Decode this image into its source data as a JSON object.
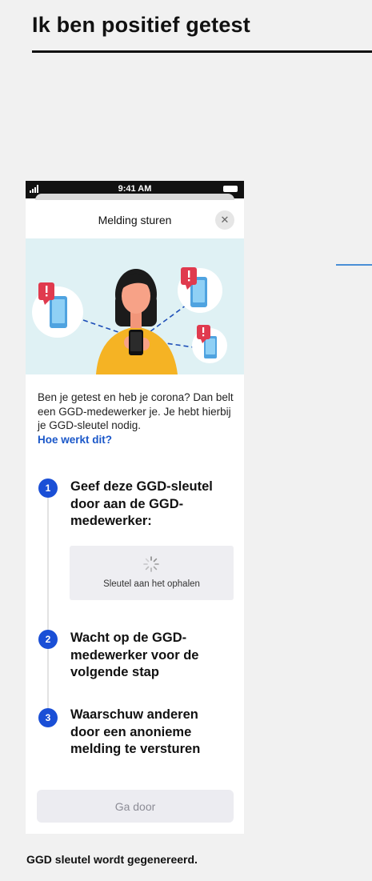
{
  "page": {
    "title": "Ik ben positief getest",
    "caption": "GGD sleutel wordt gegenereerd."
  },
  "statusbar": {
    "time": "9:41 AM"
  },
  "sheet": {
    "title": "Melding sturen",
    "close_icon": "close-icon",
    "intro_text": "Ben je getest en heb je corona? Dan belt een GGD-medewerker je. Je hebt hierbij je GGD-sleutel nodig.",
    "intro_link": "Hoe werkt dit?"
  },
  "steps": [
    {
      "number": "1",
      "text": "Geef deze GGD-sleutel door aan de GGD-medewerker:"
    },
    {
      "number": "2",
      "text": "Wacht op de GGD-medewerker voor de volgende stap"
    },
    {
      "number": "3",
      "text": "Waarschuw anderen door een anonieme melding te versturen"
    }
  ],
  "key_box": {
    "status": "Sleutel aan het ophalen",
    "icon": "loading-spinner-icon"
  },
  "buttons": {
    "continue": "Ga door"
  },
  "colors": {
    "accent_blue": "#1a4fd6",
    "link_blue": "#1a57c9",
    "alert_red": "#e03a4e",
    "illustration_bg": "#dff1f4",
    "shirt_yellow": "#f5b324"
  }
}
